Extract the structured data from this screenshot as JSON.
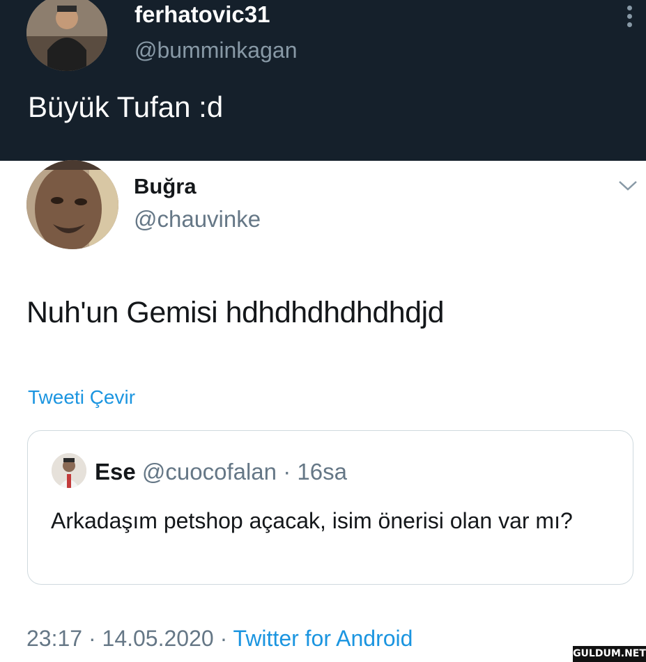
{
  "top_tweet": {
    "author_name": "ferhatovic31",
    "author_handle": "@bumminkagan",
    "text": "Büyük Tufan :d",
    "background": "#15202b"
  },
  "main_tweet": {
    "author_name": "Buğra",
    "author_handle": "@chauvinke",
    "text": "Nuh'un Gemisi hdhdhdhdhdhdjd",
    "translate_label": "Tweeti Çevir",
    "time": "23:17",
    "date": "14.05.2020",
    "separator": "·",
    "client": "Twitter for Android"
  },
  "quoted_tweet": {
    "author_name": "Ese",
    "author_handle": "@cuocofalan",
    "separator": "·",
    "time_ago": "16sa",
    "text": "Arkadaşım petshop açacak, isim önerisi olan var mı?"
  },
  "icons": {
    "more": "more-vertical-icon",
    "caret": "chevron-down-icon"
  },
  "colors": {
    "link": "#1b95e0",
    "muted": "#657786",
    "text": "#14171a"
  }
}
